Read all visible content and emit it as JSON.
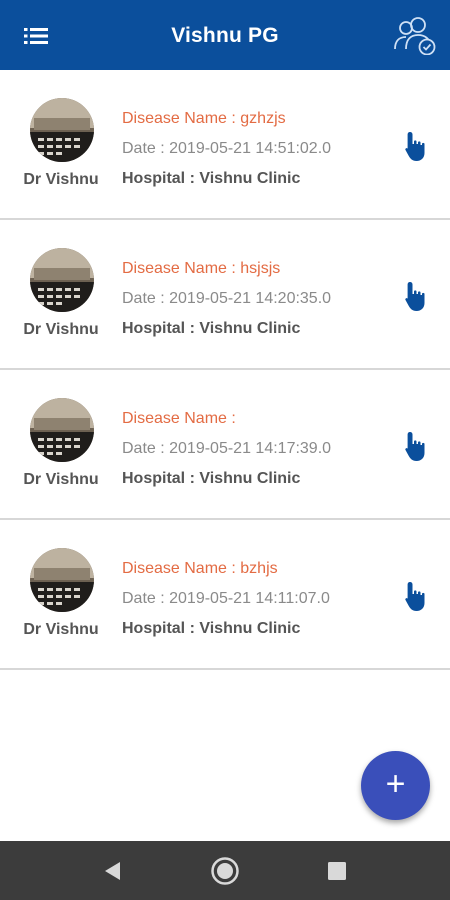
{
  "appbar": {
    "title": "Vishnu PG",
    "menu_icon": "list-menu-icon",
    "users_icon": "user-group-verified-icon"
  },
  "colors": {
    "appbar": "#0b4f9c",
    "disease_text": "#e36b43",
    "fab": "#3a4fba",
    "navbar": "#3c3c3c",
    "accent_icon": "#0b4f9c"
  },
  "records": [
    {
      "doctor": "Dr Vishnu",
      "disease": "Disease Name : gzhzjs",
      "date": "Date : 2019-05-21 14:51:02.0",
      "hospital": "Hospital : Vishnu Clinic"
    },
    {
      "doctor": "Dr Vishnu",
      "disease": "Disease Name : hsjsjs",
      "date": "Date : 2019-05-21 14:20:35.0",
      "hospital": "Hospital : Vishnu Clinic"
    },
    {
      "doctor": "Dr Vishnu",
      "disease": "Disease Name : ",
      "date": "Date : 2019-05-21 14:17:39.0",
      "hospital": "Hospital : Vishnu Clinic"
    },
    {
      "doctor": "Dr Vishnu",
      "disease": "Disease Name : bzhjs",
      "date": "Date : 2019-05-21 14:11:07.0",
      "hospital": "Hospital : Vishnu Clinic"
    }
  ],
  "fab": {
    "label": "+"
  },
  "navbar": {
    "back_icon": "back-triangle-icon",
    "home_icon": "home-circle-icon",
    "recents_icon": "recents-square-icon"
  }
}
